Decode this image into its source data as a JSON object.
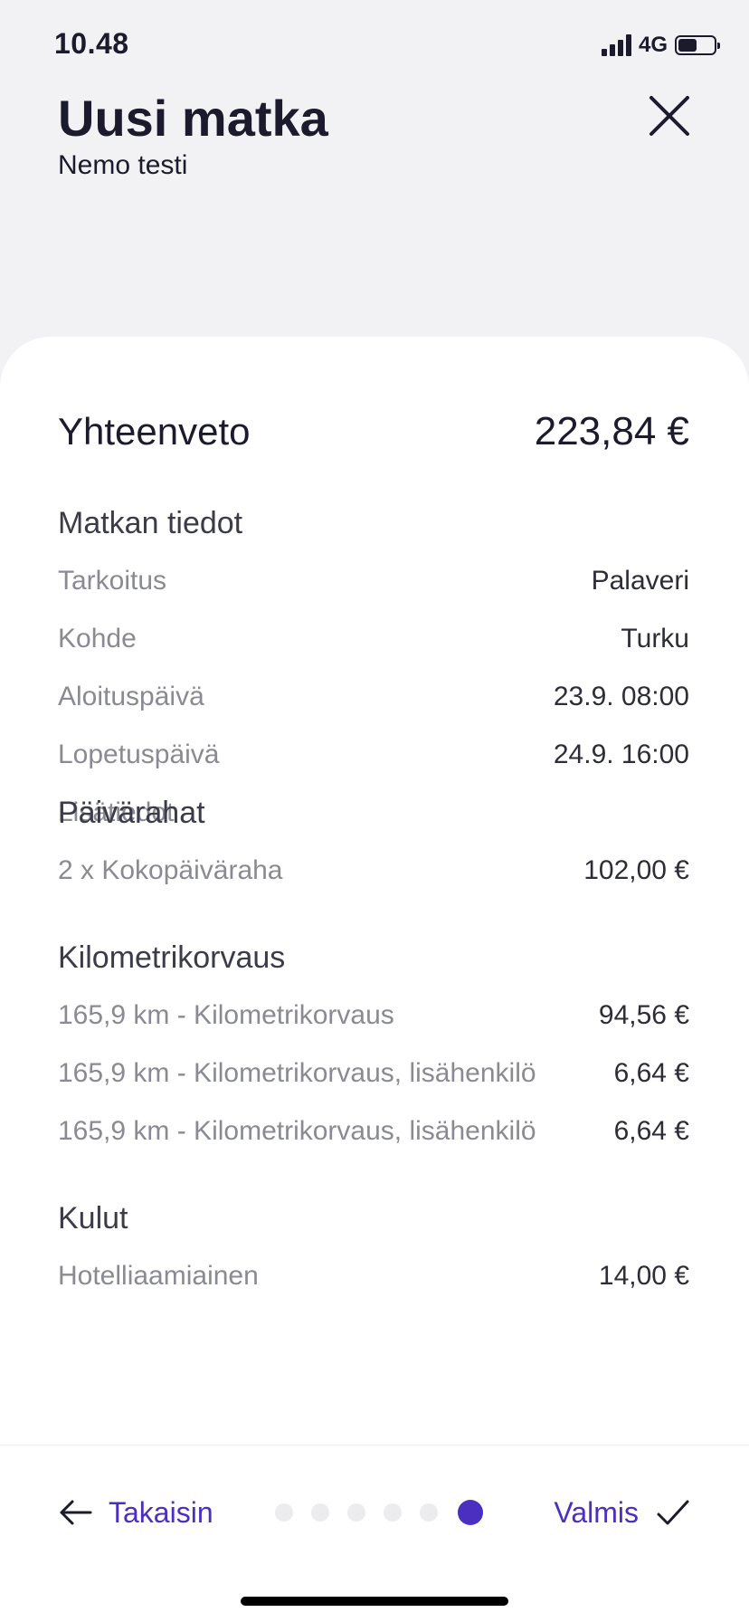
{
  "status_bar": {
    "time": "10.48",
    "network": "4G",
    "icons": [
      "signal-icon",
      "battery-icon"
    ]
  },
  "header": {
    "title": "Uusi matka",
    "subtitle": "Nemo testi",
    "close_icon": "close-icon"
  },
  "summary": {
    "title": "Yhteenveto",
    "total": "223,84 €"
  },
  "trip_details": {
    "title": "Matkan tiedot",
    "rows": [
      {
        "label": "Tarkoitus",
        "value": "Palaveri"
      },
      {
        "label": "Kohde",
        "value": "Turku"
      },
      {
        "label": "Aloituspäivä",
        "value": "23.9. 08:00"
      },
      {
        "label": "Lopetuspäivä",
        "value": "24.9. 16:00"
      },
      {
        "label": "Lisätiedot",
        "value": ""
      }
    ]
  },
  "daily_allowances": {
    "title": "Päivärahat",
    "rows": [
      {
        "label": "2 x Kokopäiväraha",
        "value": "102,00 €"
      }
    ]
  },
  "mileage": {
    "title": "Kilometrikorvaus",
    "rows": [
      {
        "label": "165,9 km - Kilometrikorvaus",
        "value": "94,56 €"
      },
      {
        "label": "165,9 km - Kilometrikorvaus, lisähenkilö",
        "value": "6,64 €"
      },
      {
        "label": "165,9 km - Kilometrikorvaus, lisähenkilö",
        "value": "6,64 €"
      }
    ]
  },
  "expenses": {
    "title": "Kulut",
    "rows": [
      {
        "label": "Hotelliaamiainen",
        "value": "14,00 €"
      }
    ]
  },
  "footer": {
    "back_label": "Takaisin",
    "done_label": "Valmis",
    "steps_total": 6,
    "current_step": 6,
    "colors": {
      "accent": "#4a2fc0",
      "inactive_dot": "#ececee"
    }
  }
}
